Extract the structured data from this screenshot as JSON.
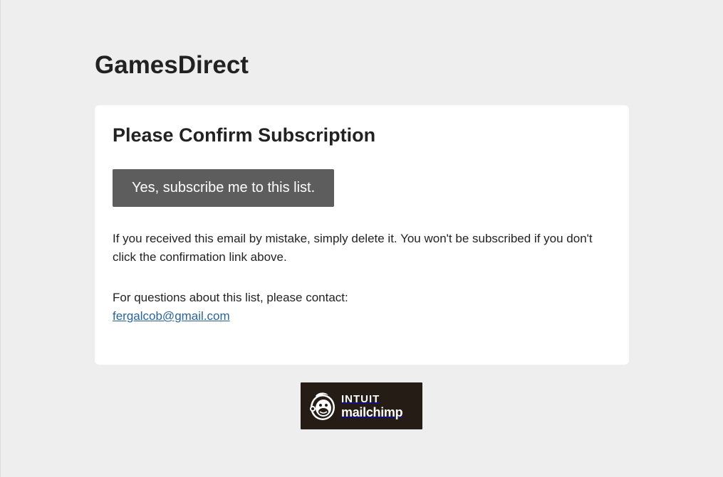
{
  "brand": {
    "title": "GamesDirect"
  },
  "card": {
    "title": "Please Confirm Subscription",
    "confirm_button": "Yes, subscribe me to this list.",
    "mistake_text": "If you received this email by mistake, simply delete it. You won't be subscribed if you don't click the confirmation link above.",
    "contact_text": "For questions about this list, please contact:",
    "contact_email": "fergalcob@gmail.com"
  },
  "footer": {
    "badge_line1": "INTUIT",
    "badge_line2": "mailchimp",
    "badge_icon": "freddie-chimp-icon"
  },
  "colors": {
    "background": "#eeeeee",
    "card": "#ffffff",
    "button": "#5d5d5d",
    "link": "#2a6496",
    "badge": "#241c15"
  }
}
